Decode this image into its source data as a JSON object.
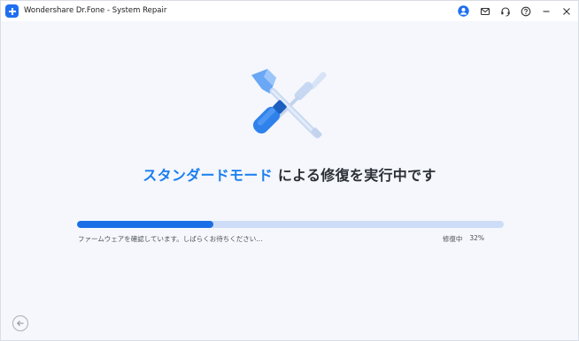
{
  "window": {
    "title": "Wondershare Dr.Fone - System Repair"
  },
  "titlebar": {
    "icons": [
      "account-icon",
      "mail-icon",
      "headset-icon",
      "help-icon",
      "minimize-icon",
      "close-icon"
    ]
  },
  "main": {
    "heading_accent": "スタンダードモード",
    "heading_rest": " による修復を実行中です",
    "progress_percent": 32,
    "status_message": "ファームウェアを確認しています。しばらくお待ちください...",
    "status_label": "修復中",
    "status_percent_text": "32%"
  },
  "colors": {
    "accent": "#1a7ef0",
    "progress_fill": "#1a6fe6",
    "progress_track": "#cdddf7"
  }
}
